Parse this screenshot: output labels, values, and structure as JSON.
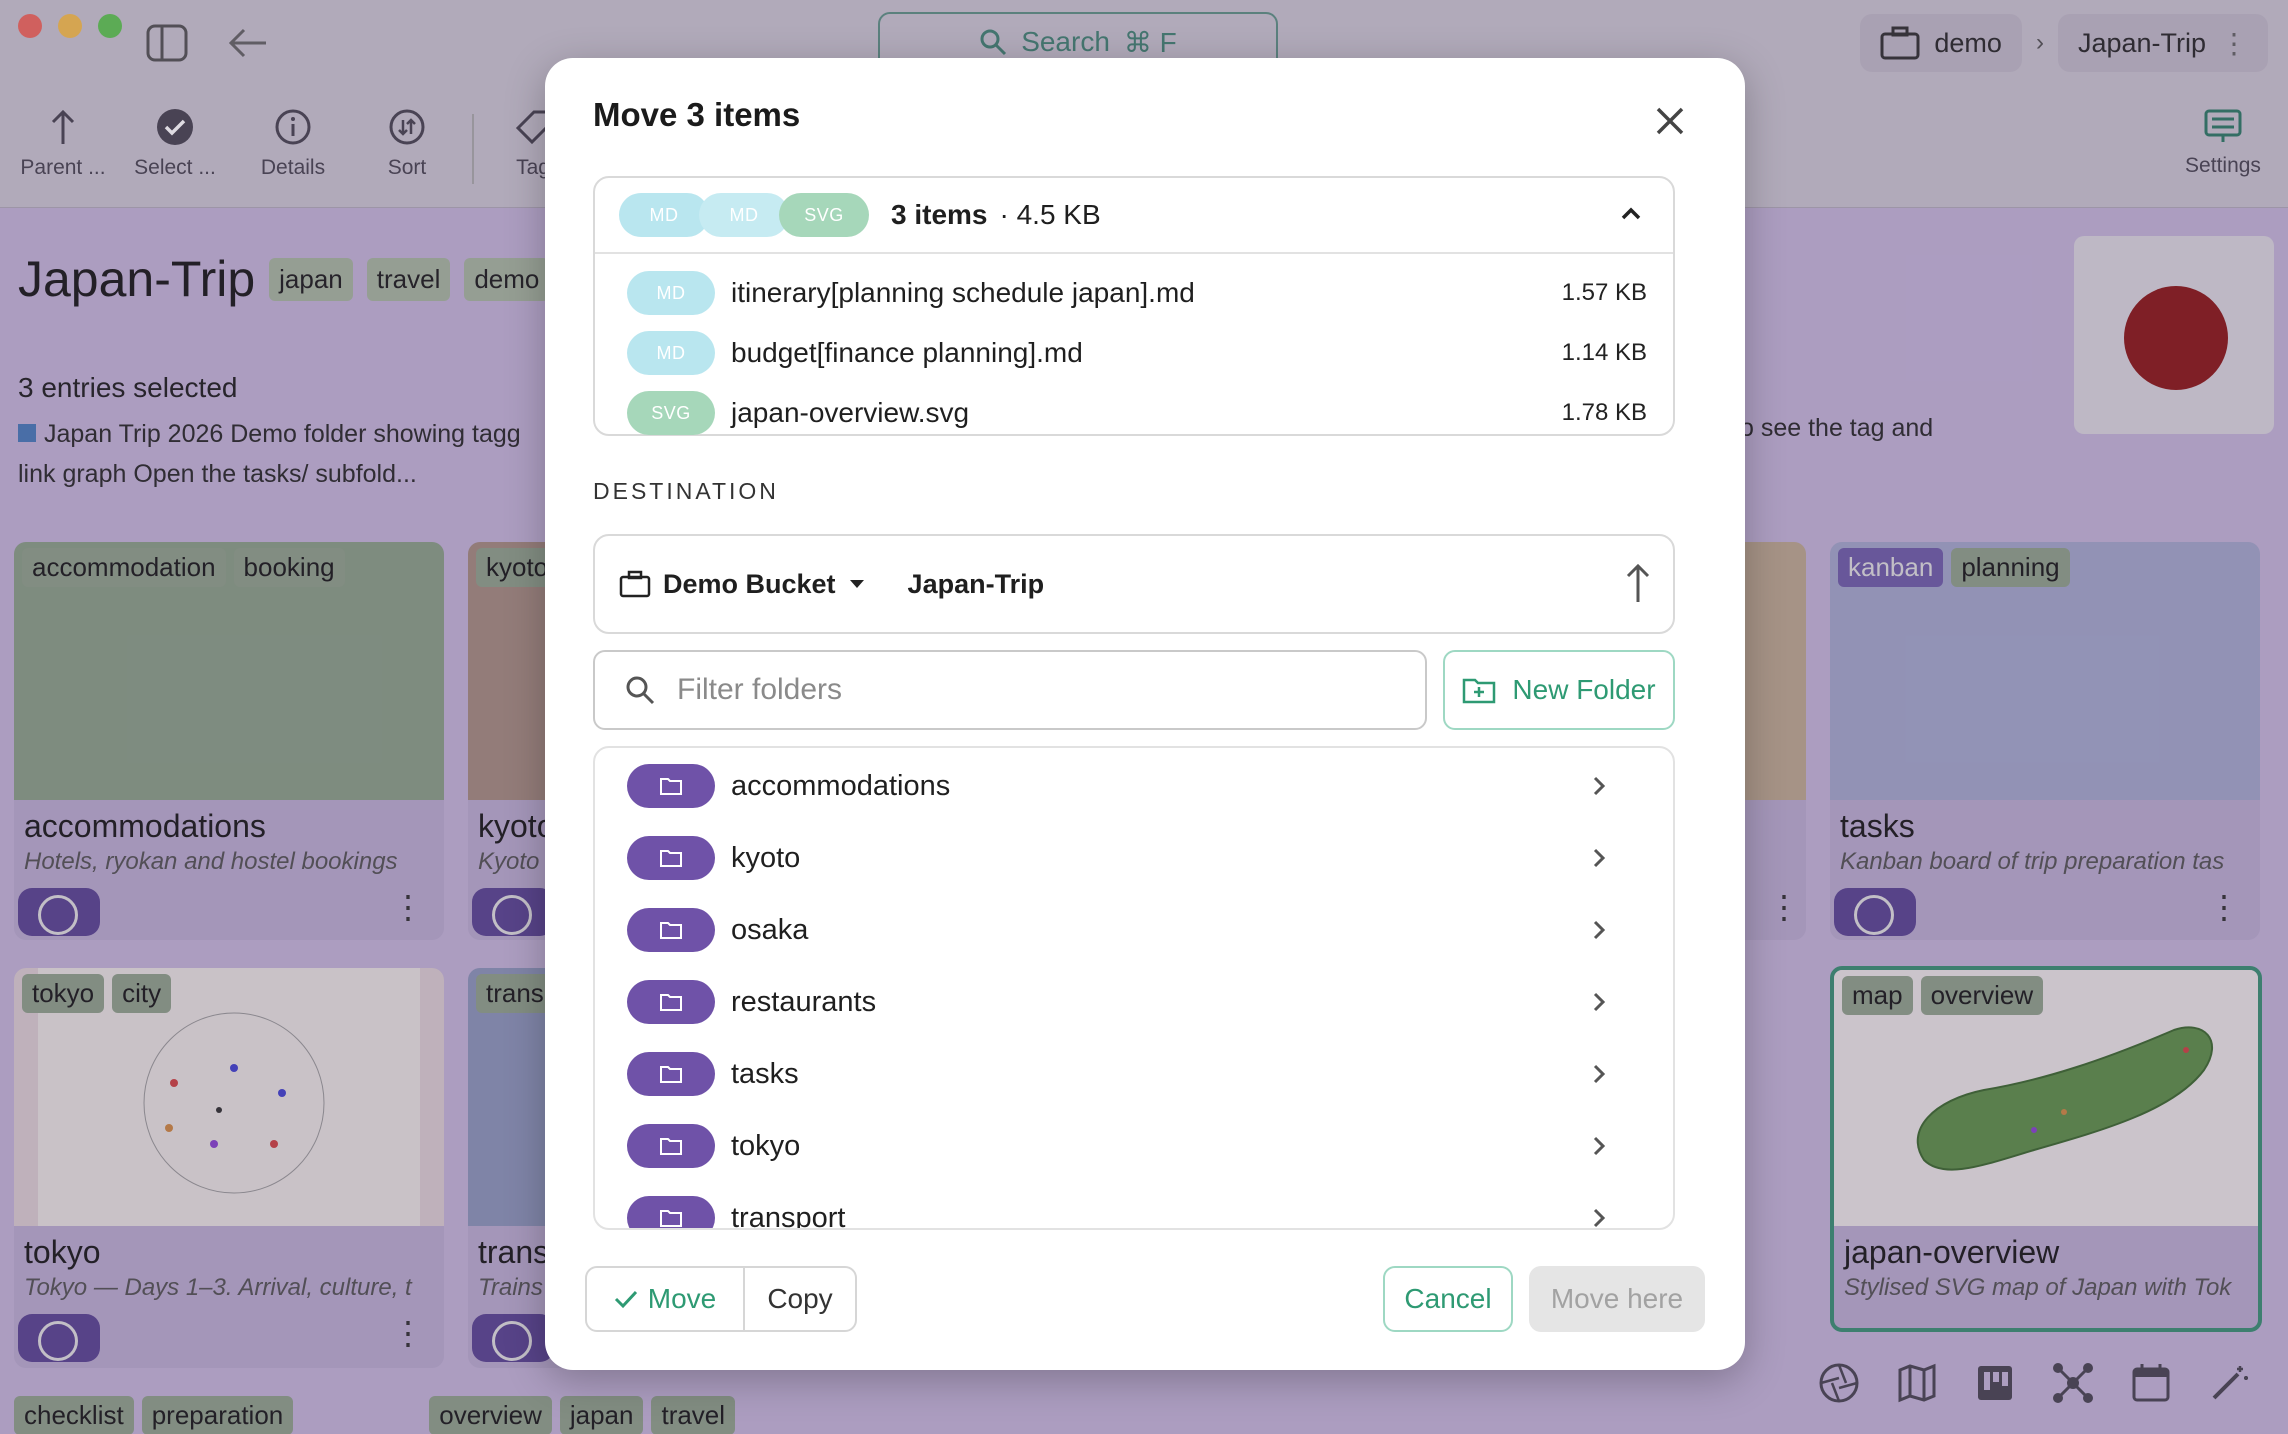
{
  "app": {
    "search_label": "Search",
    "search_shortcut": "⌘ F",
    "breadcrumb": {
      "location": "demo",
      "folder": "Japan-Trip"
    },
    "toolbar": [
      {
        "label": "Parent ...",
        "icon": "arrow-up-icon"
      },
      {
        "label": "Select ...",
        "icon": "check-circle-icon"
      },
      {
        "label": "Details",
        "icon": "info-icon"
      },
      {
        "label": "Sort",
        "icon": "sort-icon"
      },
      {
        "label": "Tag",
        "icon": "tag-icon"
      }
    ],
    "settings_label": "Settings",
    "folder_title": "Japan-Trip",
    "folder_tags": [
      "japan",
      "travel",
      "demo"
    ],
    "selection_info": "3 entries selected",
    "description_left": "Japan Trip 2026 Demo folder showing tagg",
    "description_left_2": "link graph Open the tasks/ subfold...",
    "description_right": "o see the tag and",
    "cards": [
      {
        "tags": [
          "accommodation",
          "booking"
        ],
        "name": "accommodations",
        "desc": "Hotels, ryokan and hostel bookings"
      },
      {
        "tags": [
          "kyoto"
        ],
        "name": "kyoto",
        "desc": "Kyoto"
      },
      {
        "tags": [
          "kanban",
          "planning"
        ],
        "name": "tasks",
        "desc": "Kanban board of trip preparation tas"
      },
      {
        "tags": [
          "tokyo",
          "city"
        ],
        "name": "tokyo",
        "desc": "Tokyo — Days 1–3. Arrival, culture, t"
      },
      {
        "tags": [
          "trans"
        ],
        "name": "trans",
        "desc": "Trains"
      },
      {
        "tags": [
          "map",
          "overview"
        ],
        "name": "japan-overview",
        "desc": "Stylised SVG map of Japan with Tok"
      }
    ],
    "bottom_tags": [
      "checklist",
      "preparation"
    ],
    "bottom_tags_2": [
      "overview",
      "japan",
      "travel"
    ]
  },
  "dialog": {
    "title": "Move 3 items",
    "summary": {
      "pills": [
        "MD",
        "MD",
        "SVG"
      ],
      "count": "3 items",
      "size": "· 4.5 KB"
    },
    "files": [
      {
        "type": "MD",
        "name": "itinerary[planning schedule japan].md",
        "size": "1.57 KB"
      },
      {
        "type": "MD",
        "name": "budget[finance planning].md",
        "size": "1.14 KB"
      },
      {
        "type": "SVG",
        "name": "japan-overview.svg",
        "size": "1.78 KB"
      }
    ],
    "destination_label": "DESTINATION",
    "bucket": "Demo Bucket",
    "dest_folder": "Japan-Trip",
    "filter_placeholder": "Filter folders",
    "new_folder_label": "New Folder",
    "folders": [
      "accommodations",
      "kyoto",
      "osaka",
      "restaurants",
      "tasks",
      "tokyo",
      "transport"
    ],
    "mode_move": "Move",
    "mode_copy": "Copy",
    "cancel_label": "Cancel",
    "move_here_label": "Move here"
  }
}
